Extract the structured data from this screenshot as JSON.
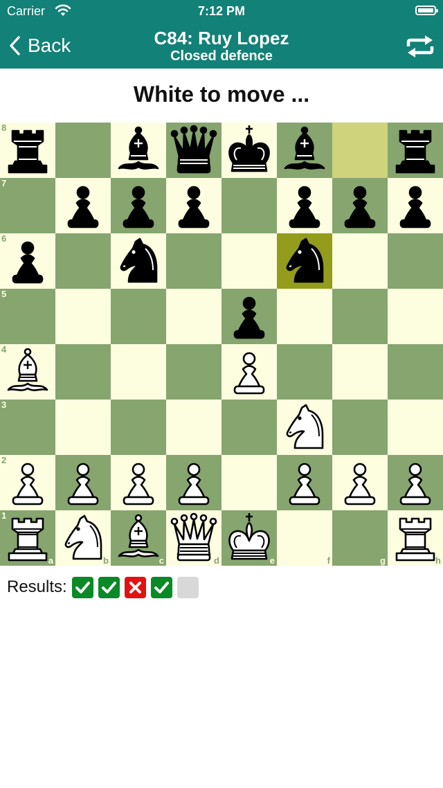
{
  "status_bar": {
    "carrier": "Carrier",
    "time": "7:12 PM"
  },
  "nav": {
    "back_label": "Back",
    "title": "C84: Ruy Lopez",
    "subtitle": "Closed defence"
  },
  "prompt": "White to move ...",
  "board": {
    "colors": {
      "light": "#fdfde0",
      "dark": "#86a56f",
      "last_move_from": "#cfd37b",
      "last_move_to": "#949c1c"
    },
    "ranks": [
      "8",
      "7",
      "6",
      "5",
      "4",
      "3",
      "2",
      "1"
    ],
    "files": [
      "a",
      "b",
      "c",
      "d",
      "e",
      "f",
      "g",
      "h"
    ],
    "pieces": [
      {
        "square": "a8",
        "piece": "black-rook"
      },
      {
        "square": "c8",
        "piece": "black-bishop"
      },
      {
        "square": "d8",
        "piece": "black-queen"
      },
      {
        "square": "e8",
        "piece": "black-king"
      },
      {
        "square": "f8",
        "piece": "black-bishop"
      },
      {
        "square": "h8",
        "piece": "black-rook"
      },
      {
        "square": "b7",
        "piece": "black-pawn"
      },
      {
        "square": "c7",
        "piece": "black-pawn"
      },
      {
        "square": "d7",
        "piece": "black-pawn"
      },
      {
        "square": "f7",
        "piece": "black-pawn"
      },
      {
        "square": "g7",
        "piece": "black-pawn"
      },
      {
        "square": "h7",
        "piece": "black-pawn"
      },
      {
        "square": "a6",
        "piece": "black-pawn"
      },
      {
        "square": "c6",
        "piece": "black-knight"
      },
      {
        "square": "f6",
        "piece": "black-knight"
      },
      {
        "square": "e5",
        "piece": "black-pawn"
      },
      {
        "square": "a4",
        "piece": "white-bishop"
      },
      {
        "square": "e4",
        "piece": "white-pawn"
      },
      {
        "square": "f3",
        "piece": "white-knight"
      },
      {
        "square": "a2",
        "piece": "white-pawn"
      },
      {
        "square": "b2",
        "piece": "white-pawn"
      },
      {
        "square": "c2",
        "piece": "white-pawn"
      },
      {
        "square": "d2",
        "piece": "white-pawn"
      },
      {
        "square": "f2",
        "piece": "white-pawn"
      },
      {
        "square": "g2",
        "piece": "white-pawn"
      },
      {
        "square": "h2",
        "piece": "white-pawn"
      },
      {
        "square": "a1",
        "piece": "white-rook"
      },
      {
        "square": "b1",
        "piece": "white-knight"
      },
      {
        "square": "c1",
        "piece": "white-bishop"
      },
      {
        "square": "d1",
        "piece": "white-queen"
      },
      {
        "square": "e1",
        "piece": "white-king"
      },
      {
        "square": "h1",
        "piece": "white-rook"
      }
    ],
    "last_move": {
      "from": "g8",
      "to": "f6"
    }
  },
  "results": {
    "label": "Results:",
    "items": [
      "pass",
      "pass",
      "fail",
      "pass",
      "pending"
    ],
    "colors": {
      "pass": "#0a8a26",
      "fail": "#e01212",
      "pending": "#d8d8d8"
    }
  },
  "icons": {
    "back": "chevron-left-icon",
    "flip": "flip-board-icon",
    "wifi": "wifi-icon",
    "battery": "battery-icon",
    "pass": "check-icon",
    "fail": "cross-icon"
  }
}
